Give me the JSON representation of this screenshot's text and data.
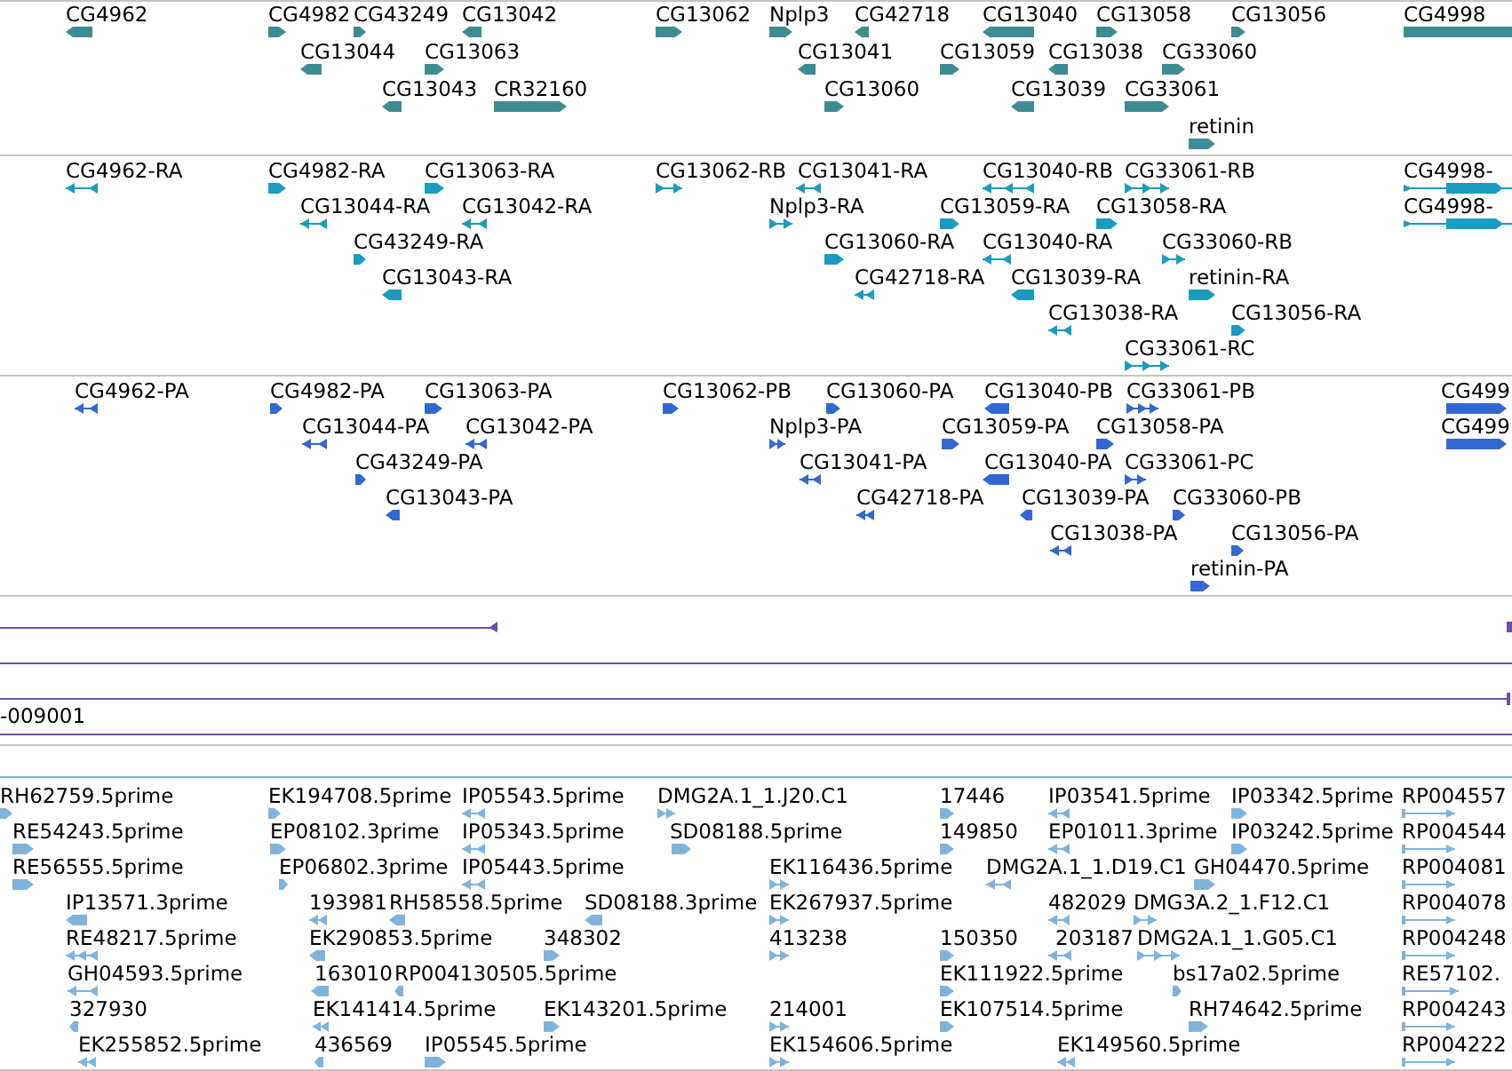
{
  "tracks": [
    {
      "kind": "gene",
      "color": "#3d8c91",
      "features": [
        {
          "label": "CG4962",
          "reverse": true
        },
        {
          "label": "CG4982",
          "reverse": false
        },
        {
          "label": "CG43249",
          "reverse": false
        },
        {
          "label": "CG13042",
          "reverse": true
        },
        {
          "label": "CG13062",
          "reverse": false
        },
        {
          "label": "Nplp3",
          "reverse": false
        },
        {
          "label": "CG42718",
          "reverse": true
        },
        {
          "label": "CG13040",
          "reverse": true
        },
        {
          "label": "CG13058",
          "reverse": false
        },
        {
          "label": "CG13056",
          "reverse": false
        },
        {
          "label": "CG4998"
        },
        {
          "label": "CG13044",
          "reverse": true
        },
        {
          "label": "CG13063",
          "reverse": false
        },
        {
          "label": "CG13041",
          "reverse": true
        },
        {
          "label": "CG13059",
          "reverse": false
        },
        {
          "label": "CG13038",
          "reverse": true
        },
        {
          "label": "CG33060",
          "reverse": false
        },
        {
          "label": "CG13043",
          "reverse": true
        },
        {
          "label": "CR32160",
          "reverse": false
        },
        {
          "label": "CG13060",
          "reverse": false
        },
        {
          "label": "CG13039",
          "reverse": true
        },
        {
          "label": "CG33061",
          "reverse": false
        },
        {
          "label": "retinin",
          "reverse": false
        }
      ]
    },
    {
      "kind": "transcript",
      "color": "#1a9cc1",
      "features": [
        {
          "label": "CG4962-RA",
          "reverse": true
        },
        {
          "label": "CG4982-RA",
          "reverse": false
        },
        {
          "label": "CG13063-RA",
          "reverse": false
        },
        {
          "label": "CG13062-RB",
          "reverse": false
        },
        {
          "label": "CG13041-RA",
          "reverse": true
        },
        {
          "label": "CG13040-RB",
          "reverse": true
        },
        {
          "label": "CG33061-RB",
          "reverse": false
        },
        {
          "label": "CG4998-",
          "reverse": false
        },
        {
          "label": "CG13044-RA",
          "reverse": true
        },
        {
          "label": "CG13042-RA",
          "reverse": true
        },
        {
          "label": "Nplp3-RA",
          "reverse": false
        },
        {
          "label": "CG13059-RA",
          "reverse": false
        },
        {
          "label": "CG13058-RA",
          "reverse": false
        },
        {
          "label": "CG4998-",
          "reverse": false
        },
        {
          "label": "CG43249-RA",
          "reverse": false
        },
        {
          "label": "CG13060-RA",
          "reverse": false
        },
        {
          "label": "CG13040-RA",
          "reverse": true
        },
        {
          "label": "CG33060-RB",
          "reverse": false
        },
        {
          "label": "CG13043-RA",
          "reverse": true
        },
        {
          "label": "CG42718-RA",
          "reverse": true
        },
        {
          "label": "CG13039-RA",
          "reverse": true
        },
        {
          "label": "retinin-RA",
          "reverse": false
        },
        {
          "label": "CG13038-RA",
          "reverse": true
        },
        {
          "label": "CG13056-RA",
          "reverse": false
        },
        {
          "label": "CG33061-RC",
          "reverse": false
        }
      ]
    },
    {
      "kind": "protein",
      "color": "#3268d2",
      "features": [
        {
          "label": "CG4962-PA",
          "reverse": true
        },
        {
          "label": "CG4982-PA",
          "reverse": false
        },
        {
          "label": "CG13063-PA",
          "reverse": false
        },
        {
          "label": "CG13062-PB",
          "reverse": false
        },
        {
          "label": "CG13060-PA",
          "reverse": false
        },
        {
          "label": "CG13040-PB",
          "reverse": true
        },
        {
          "label": "CG33061-PB",
          "reverse": false
        },
        {
          "label": "CG499",
          "reverse": false
        },
        {
          "label": "CG13044-PA",
          "reverse": true
        },
        {
          "label": "CG13042-PA",
          "reverse": true
        },
        {
          "label": "Nplp3-PA",
          "reverse": false
        },
        {
          "label": "CG13059-PA",
          "reverse": false
        },
        {
          "label": "CG13058-PA",
          "reverse": false
        },
        {
          "label": "CG499",
          "reverse": false
        },
        {
          "label": "CG43249-PA",
          "reverse": false
        },
        {
          "label": "CG13041-PA",
          "reverse": true
        },
        {
          "label": "CG13040-PA",
          "reverse": true
        },
        {
          "label": "CG33061-PC",
          "reverse": false
        },
        {
          "label": "CG13043-PA",
          "reverse": true
        },
        {
          "label": "CG42718-PA",
          "reverse": true
        },
        {
          "label": "CG13039-PA",
          "reverse": true
        },
        {
          "label": "CG33060-PB",
          "reverse": false
        },
        {
          "label": "CG13038-PA",
          "reverse": true
        },
        {
          "label": "CG13056-PA",
          "reverse": false
        },
        {
          "label": "retinin-PA",
          "reverse": false
        }
      ]
    },
    {
      "kind": "line",
      "color": "#6a4fb2",
      "labels": [
        "-009001"
      ]
    },
    {
      "kind": "est",
      "color": "#7fb3dc",
      "features": [
        {
          "label": "RH62759.5prime",
          "reverse": false
        },
        {
          "label": "EK194708.5prime",
          "reverse": false
        },
        {
          "label": "IP05543.5prime",
          "reverse": true
        },
        {
          "label": "DMG2A.1_1.J20.C1",
          "reverse": false
        },
        {
          "label": "17446",
          "reverse": false
        },
        {
          "label": "IP03541.5prime",
          "reverse": true
        },
        {
          "label": "IP03342.5prime",
          "reverse": false
        },
        {
          "label": "RP004557",
          "reverse": false
        },
        {
          "label": "RE54243.5prime",
          "reverse": false
        },
        {
          "label": "EP08102.3prime",
          "reverse": false
        },
        {
          "label": "IP05343.5prime",
          "reverse": true
        },
        {
          "label": "SD08188.5prime",
          "reverse": false
        },
        {
          "label": "149850",
          "reverse": false
        },
        {
          "label": "EP01011.3prime",
          "reverse": true
        },
        {
          "label": "IP03242.5prime",
          "reverse": false
        },
        {
          "label": "RP004544",
          "reverse": false
        },
        {
          "label": "RE56555.5prime",
          "reverse": false
        },
        {
          "label": "EP06802.3prime",
          "reverse": false
        },
        {
          "label": "IP05443.5prime",
          "reverse": true
        },
        {
          "label": "EK116436.5prime",
          "reverse": false
        },
        {
          "label": "DMG2A.1_1.D19.C1",
          "reverse": true
        },
        {
          "label": "GH04470.5prime",
          "reverse": false
        },
        {
          "label": "RP004081",
          "reverse": false
        },
        {
          "label": "IP13571.3prime",
          "reverse": true
        },
        {
          "label": "193981",
          "reverse": true
        },
        {
          "label": "RH58558.5prime",
          "reverse": true
        },
        {
          "label": "SD08188.3prime",
          "reverse": true
        },
        {
          "label": "EK267937.5prime",
          "reverse": false
        },
        {
          "label": "482029",
          "reverse": true
        },
        {
          "label": "DMG3A.2_1.F12.C1",
          "reverse": false
        },
        {
          "label": "RP004078",
          "reverse": false
        },
        {
          "label": "RE48217.5prime",
          "reverse": true
        },
        {
          "label": "EK290853.5prime",
          "reverse": true
        },
        {
          "label": "348302",
          "reverse": false
        },
        {
          "label": "413238",
          "reverse": false
        },
        {
          "label": "150350",
          "reverse": false
        },
        {
          "label": "203187",
          "reverse": true
        },
        {
          "label": "DMG2A.1_1.G05.C1",
          "reverse": false
        },
        {
          "label": "RP004248",
          "reverse": false
        },
        {
          "label": "GH04593.5prime",
          "reverse": true
        },
        {
          "label": "163010",
          "reverse": true
        },
        {
          "label": "RP004130505.5prime",
          "reverse": true
        },
        {
          "label": "EK111922.5prime",
          "reverse": false
        },
        {
          "label": "bs17a02.5prime",
          "reverse": false
        },
        {
          "label": "RE57102.",
          "reverse": false
        },
        {
          "label": "327930",
          "reverse": true
        },
        {
          "label": "EK141414.5prime",
          "reverse": true
        },
        {
          "label": "EK143201.5prime",
          "reverse": false
        },
        {
          "label": "214001",
          "reverse": false
        },
        {
          "label": "EK107514.5prime",
          "reverse": false
        },
        {
          "label": "RH74642.5prime",
          "reverse": false
        },
        {
          "label": "RP004243",
          "reverse": false
        },
        {
          "label": "EK255852.5prime",
          "reverse": true
        },
        {
          "label": "436569",
          "reverse": true
        },
        {
          "label": "IP05545.5prime",
          "reverse": false
        },
        {
          "label": "EK154606.5prime",
          "reverse": false
        },
        {
          "label": "EK149560.5prime",
          "reverse": true
        },
        {
          "label": "RP004222",
          "reverse": false
        }
      ]
    }
  ]
}
